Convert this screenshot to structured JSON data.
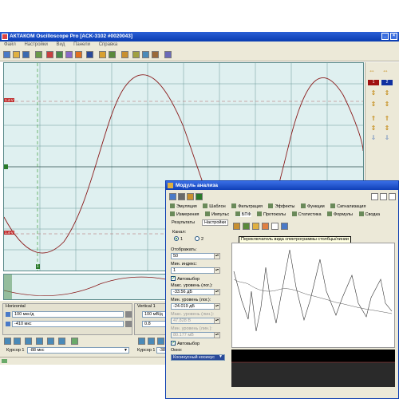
{
  "window": {
    "title": "АКТАКОМ Oscilloscope Pro [ACK-3102 #0020043]"
  },
  "menu": {
    "items": [
      "Файл",
      "Настройки",
      "Вид",
      "Панели",
      "Справка"
    ]
  },
  "scope": {
    "ch_markers": [
      "1.4-V",
      "1.4-V"
    ],
    "cursor_label": "1"
  },
  "right_panel": {
    "channels": [
      "1",
      "2"
    ]
  },
  "horizontal": {
    "title": "Horizontal",
    "timebase": "100 мкс/д",
    "offset": "-410 мкс",
    "cursor_label": "Курсор 1",
    "cursor_value": "-88 мкс"
  },
  "vertical": {
    "title": "Vertical 1",
    "volts": "100 мВ/д",
    "offset": "0.8",
    "cursor_label": "Курсор 1",
    "cursor_value": "-380"
  },
  "dialog": {
    "title": "Модуль анализа",
    "tabs_row1": [
      "Эмуляция",
      "Шаблон",
      "Фильтрация",
      "Эффекты",
      "Функции",
      "Сигнализация"
    ],
    "tabs_row2": [
      "Измерения",
      "Импульс",
      "БПФ",
      "Протоколы",
      "Статистика",
      "Формулы",
      "Сводка"
    ],
    "subtabs": [
      "Результаты",
      "Настройки"
    ],
    "tooltip": "Переключатель вида спектрограммы столбцы/линии",
    "settings": {
      "channel_label": "Канал:",
      "channel_options": [
        "1",
        "2"
      ],
      "display_label": "Отображать:",
      "display_value": "50",
      "min_index_label": "Мин. индекс:",
      "min_index_value": "1",
      "autoselect_1": "Автовыбор",
      "max_level_label": "Макс. уровень (лог.):",
      "max_level_value": "-33.56 дБ",
      "min_level_label": "Мин. уровень (лог.):",
      "min_level_value": "-24.019 дБ",
      "max_level_lin_label": "Макс. уровень (лин.):",
      "max_level_lin_value": "47.828 В",
      "min_level_lin_label": "Мин. уровень (лин.):",
      "min_level_lin_value": "80.177 мВ",
      "autoselect_2": "Автовыбор",
      "window_label": "Окно:",
      "window_value": "Косинусный косинус"
    }
  }
}
